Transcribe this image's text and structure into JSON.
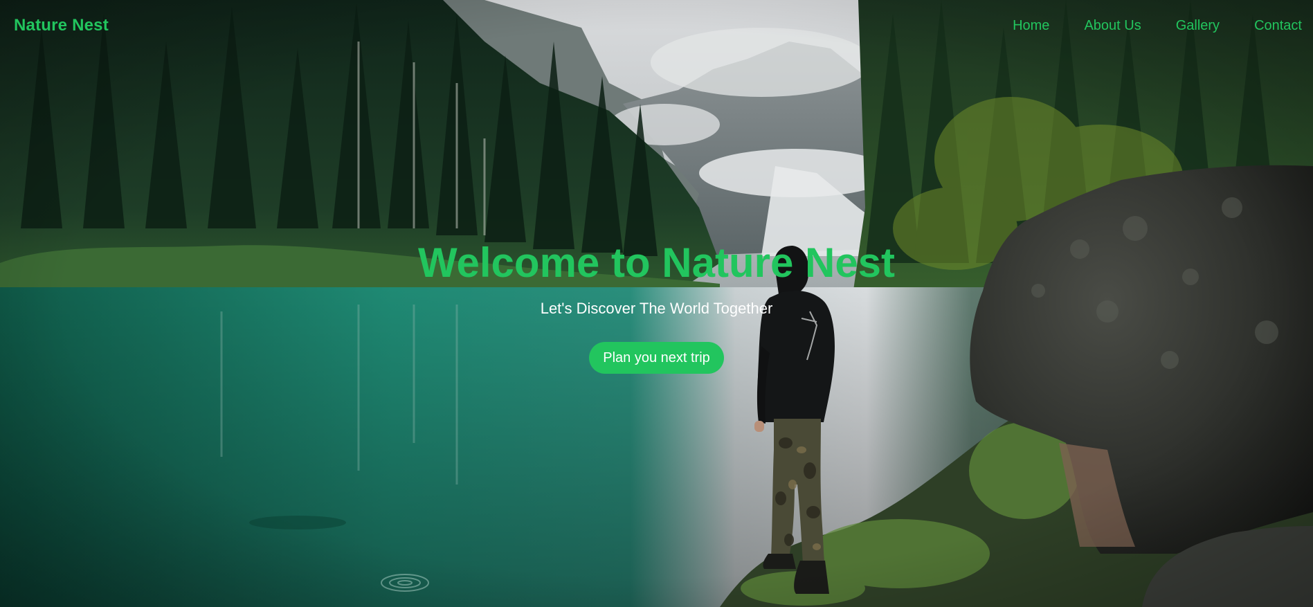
{
  "navbar": {
    "brand": "Nature Nest",
    "links": [
      {
        "label": "Home"
      },
      {
        "label": "About Us"
      },
      {
        "label": "Gallery"
      },
      {
        "label": "Contact"
      }
    ]
  },
  "hero": {
    "title": "Welcome to Nature Nest",
    "subtitle": "Let's Discover The World Together",
    "cta_label": "Plan you next trip"
  },
  "theme": {
    "accent": "#22c55e",
    "text_light": "#ffffff"
  }
}
